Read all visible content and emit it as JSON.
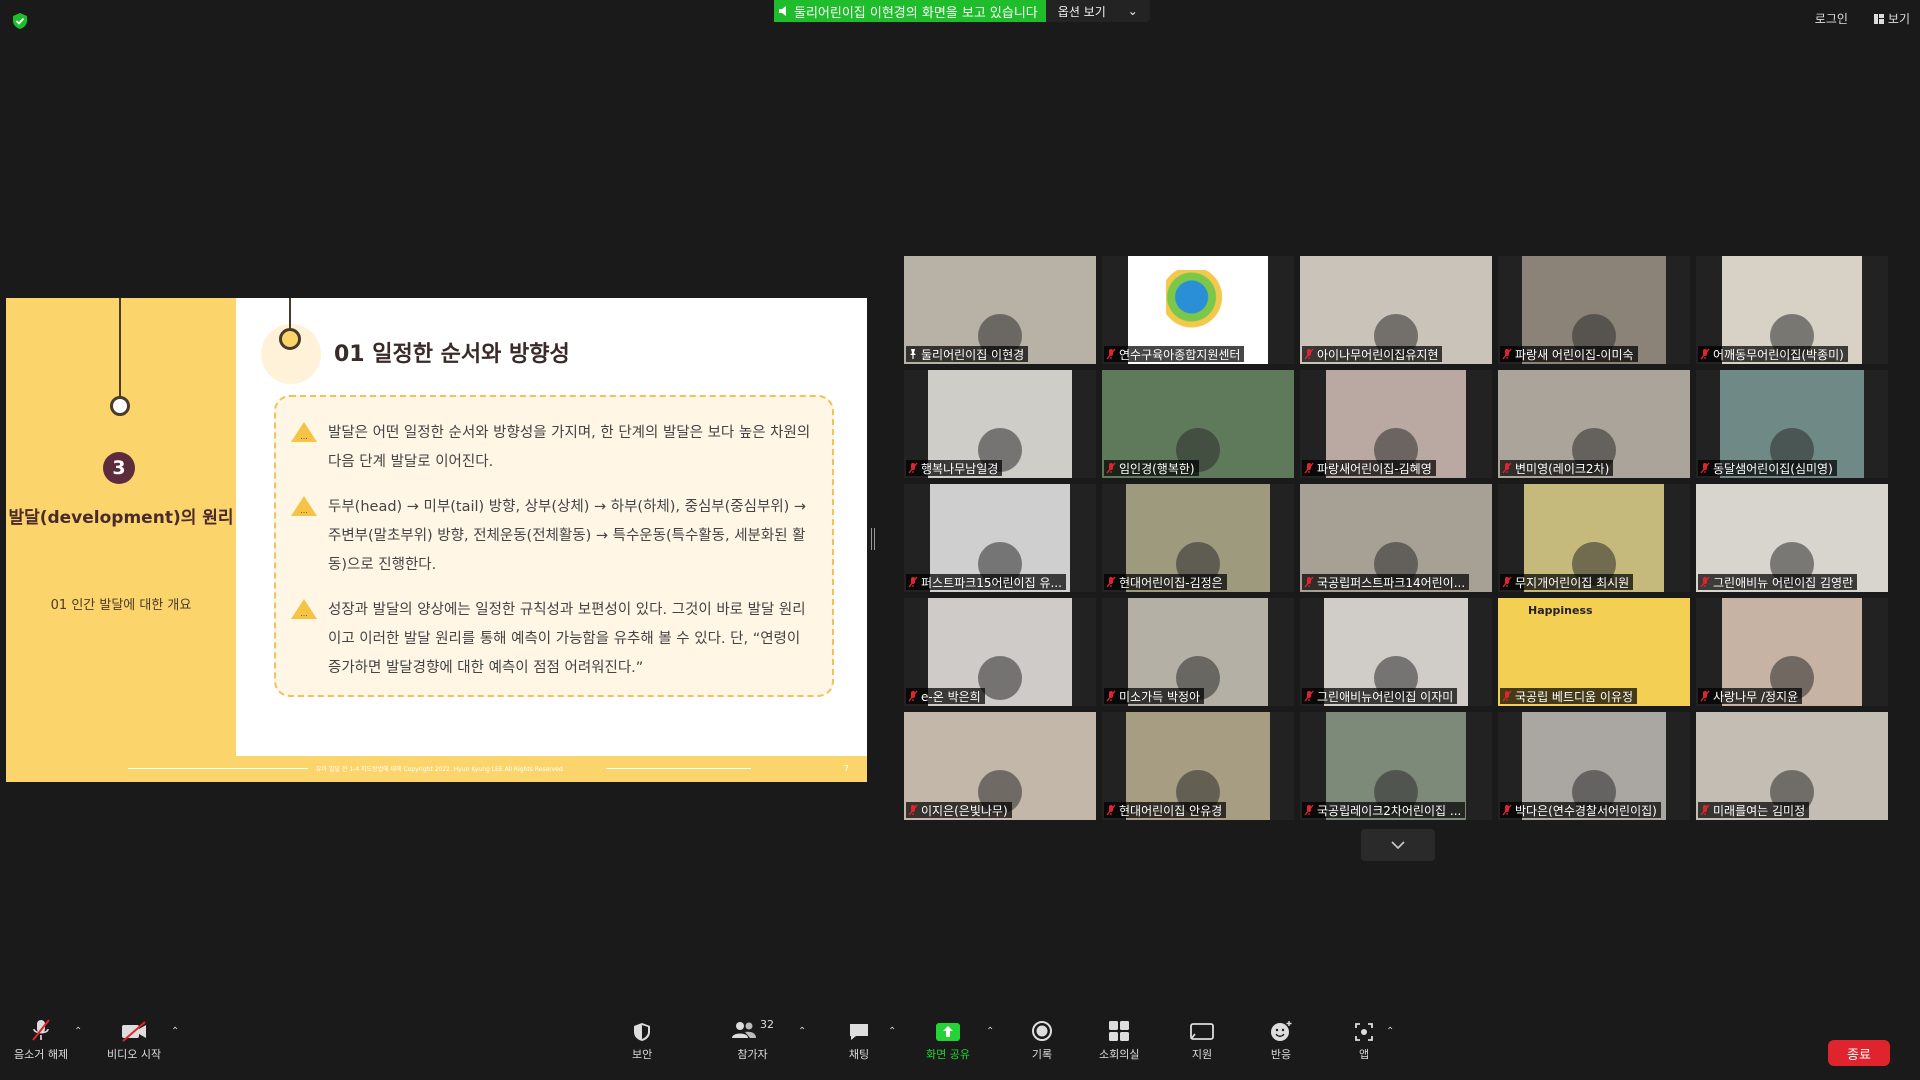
{
  "top": {
    "share_banner": "둘리어린이집 이현경의 화면을 보고 있습니다",
    "options_label": "옵션 보기",
    "login_label": "로그인",
    "view_label": "보기"
  },
  "slide": {
    "number": "3",
    "left_title": "발달(development)의 원리",
    "left_subtitle": "01 인간 발달에 대한 개요",
    "heading": "01 일정한 순서와 방향성",
    "bullets": [
      "발달은 어떤 일정한 순서와 방향성을 가지며, 한 단계의 발달은 보다 높은 차원의 다음 단계 발달로 이어진다.",
      "두부(head) → 미부(tail) 방향, 상부(상체) → 하부(하체), 중심부(중심부위) → 주변부(말초부위) 방향, 전체운동(전체활동) → 특수운동(특수활동, 세분화된 활동)으로 진행한다.",
      "성장과 발달의 양상에는 일정한 규칙성과 보편성이 있다. 그것이 바로 발달 원리이고 이러한 발달 원리를 통해 예측이 가능함을 유추해 볼 수 있다. 단, “연령이 증가하면 발달경향에 대한 예측이 점점 어려워진다.”"
    ],
    "footer": "유아 발달 전 1-4 지도방법에 대해 Copyright 2022. Hyun Kyung LEE All Rights Reserved.",
    "page": "7"
  },
  "participants": [
    {
      "name": "둘리어린이집 이현경",
      "active": true,
      "muted": false,
      "bg": "#b8b2a6"
    },
    {
      "name": "연수구육아종합지원센터",
      "muted": true,
      "bg": "#ffffff"
    },
    {
      "name": "아이나무어린이집유지현",
      "muted": true,
      "bg": "#c9c3ba"
    },
    {
      "name": "파랑새 어린이집-이미숙",
      "muted": true,
      "bg": "#8c8378"
    },
    {
      "name": "어깨동무어린이집(박종미)",
      "muted": true,
      "bg": "#d8d2c6"
    },
    {
      "name": "행복나무남일경",
      "muted": true,
      "bg": "#cfcdc8"
    },
    {
      "name": "임인경(행복한)",
      "muted": true,
      "bg": "#5f7a5a"
    },
    {
      "name": "파랑새어린이집-김혜영",
      "muted": true,
      "bg": "#b9a9a2"
    },
    {
      "name": "변미영(레이크2차)",
      "muted": true,
      "bg": "#aaa49a"
    },
    {
      "name": "동달샘어린이집(심미영)",
      "muted": true,
      "bg": "#6f8a86"
    },
    {
      "name": "퍼스트파크15어린이집 유...",
      "muted": true,
      "bg": "#cfcfcf"
    },
    {
      "name": "현대어린이집-김정은",
      "muted": true,
      "bg": "#9e9a7e"
    },
    {
      "name": "국공립퍼스트파크14어린이...",
      "muted": true,
      "bg": "#a7a195"
    },
    {
      "name": "무지개어린이집 최시원",
      "muted": true,
      "bg": "#c6b97c"
    },
    {
      "name": "그린애비뉴 어린이집 김영란",
      "muted": true,
      "bg": "#d8d4ce"
    },
    {
      "name": "e-온 박은희",
      "muted": true,
      "bg": "#cfcbc8"
    },
    {
      "name": "미소가득 박정아",
      "muted": true,
      "bg": "#b4b0a5"
    },
    {
      "name": "그린애비뉴어린이집 이자미",
      "muted": true,
      "bg": "#d0ccc7"
    },
    {
      "name": "국공립 베트디움 이유정",
      "muted": true,
      "bg": "#f3cf54",
      "overlay": "Happiness"
    },
    {
      "name": "사랑나무 /정지윤",
      "muted": true,
      "bg": "#c6b3a3"
    },
    {
      "name": "이지은(은빛나무)",
      "muted": true,
      "bg": "#c2b7a8"
    },
    {
      "name": "현대어린이집 안유경",
      "muted": true,
      "bg": "#a69d83"
    },
    {
      "name": "국공립레이크2차어린이집 ...",
      "muted": true,
      "bg": "#7d8a7a"
    },
    {
      "name": "박다은(연수경찰서어린이집)",
      "muted": true,
      "bg": "#aaa7a2"
    },
    {
      "name": "미래를여는 김미정",
      "muted": true,
      "bg": "#c4bdb4"
    }
  ],
  "toolbar": {
    "unmute": "음소거 해제",
    "start_video": "비디오 시작",
    "security": "보안",
    "participants": "참가자",
    "participants_count": "32",
    "chat": "채팅",
    "share_screen": "화면 공유",
    "record": "기록",
    "breakout": "소회의실",
    "support": "지원",
    "reactions": "반응",
    "apps": "앱",
    "end": "종료"
  },
  "colors": {
    "accent_green": "#1fbd2c",
    "end_red": "#e0242e",
    "slide_yellow": "#fbd46c",
    "active_speaker": "#d4e04a"
  }
}
